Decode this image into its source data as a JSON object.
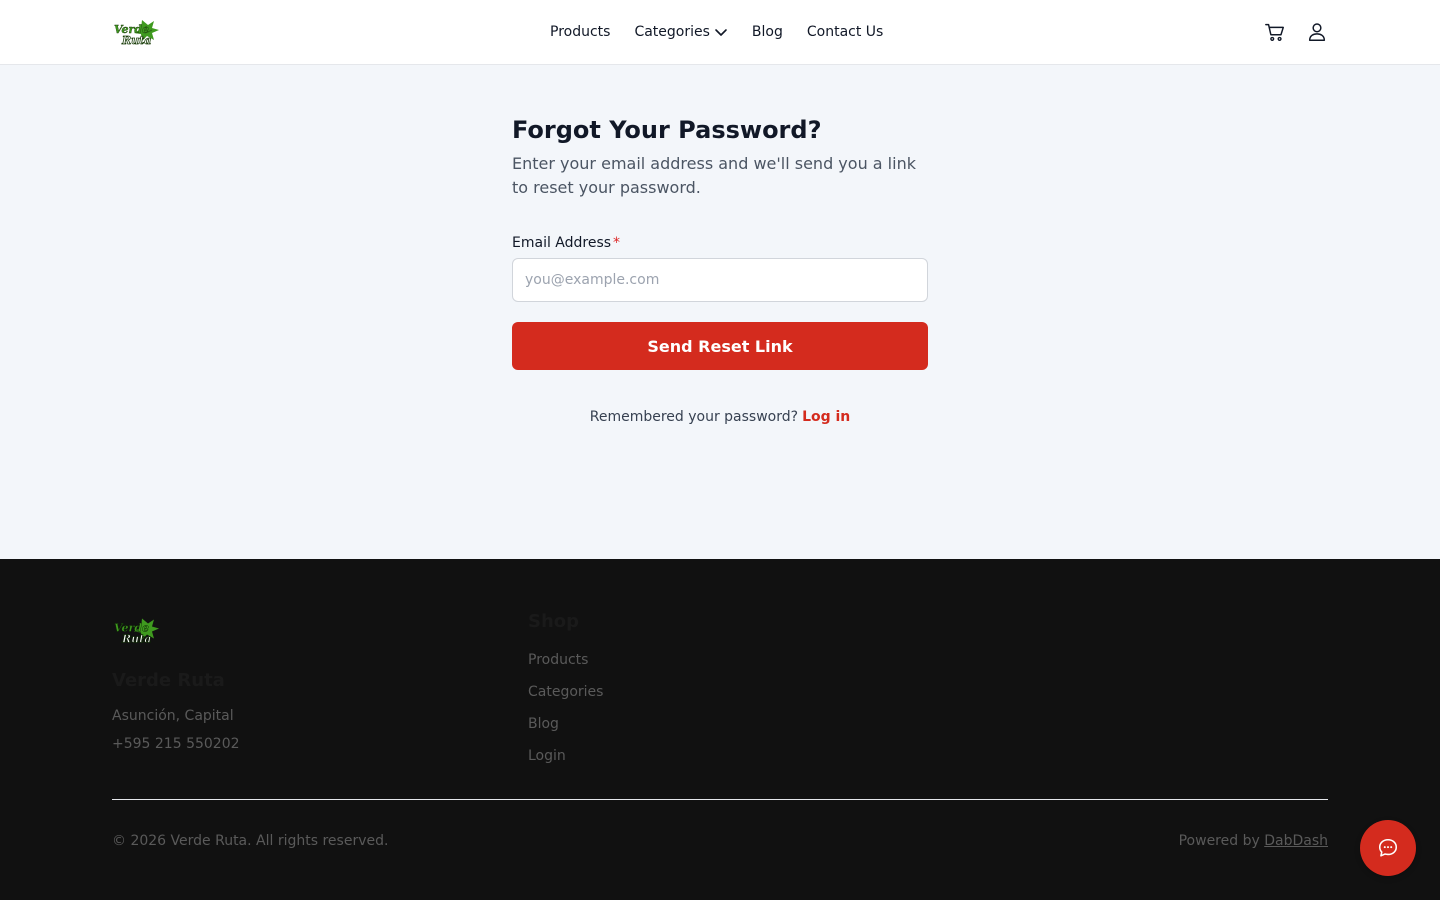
{
  "header": {
    "logo_text": "Verde Ruta",
    "nav": [
      {
        "label": "Products"
      },
      {
        "label": "Categories"
      },
      {
        "label": "Blog"
      },
      {
        "label": "Contact Us"
      }
    ],
    "icons": [
      "cart-icon",
      "user-icon"
    ]
  },
  "form": {
    "title": "Forgot Your Password?",
    "subtitle": "Enter your email address and we'll send you a link to reset your password.",
    "email_label": "Email Address",
    "required_mark": "*",
    "email_placeholder": "you@example.com",
    "email_value": "",
    "submit_label": "Send Reset Link",
    "remember_text": "Remembered your password?",
    "login_link": "Log in"
  },
  "footer": {
    "brand": "Verde Ruta",
    "address": "Asunción, Capital",
    "phone": "+595 215 550202",
    "shop_heading": "Shop",
    "shop_links": [
      "Products",
      "Categories",
      "Blog",
      "Login"
    ],
    "copyright": "© 2026 Verde Ruta. All rights reserved.",
    "powered_prefix": "Powered by",
    "powered_link": "DabDash"
  },
  "chat": {
    "icon": "chat-bubble-icon"
  },
  "colors": {
    "accent": "#d42b1e",
    "page_bg": "#f3f6fa",
    "footer_bg": "#111111",
    "logo_green": "#3f9a1f"
  }
}
